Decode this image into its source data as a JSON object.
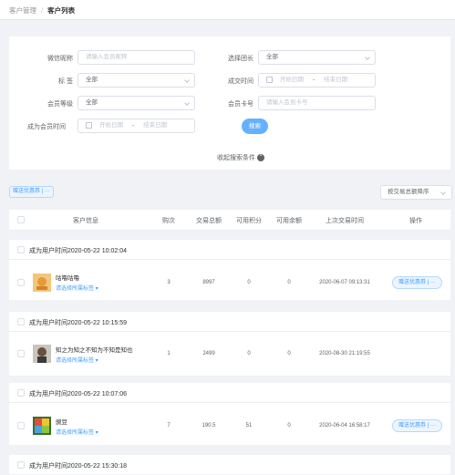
{
  "breadcrumb": {
    "parent": "客户管理",
    "current": "客户列表"
  },
  "filters": {
    "nickname": {
      "label": "微信昵称",
      "placeholder": "请输入会员昵称"
    },
    "leader": {
      "label": "选择团长",
      "value": "全部"
    },
    "tag": {
      "label": "标 签",
      "value": "全部"
    },
    "deal_time": {
      "label": "成交时间",
      "start_placeholder": "开始日期",
      "end_placeholder": "结束日期",
      "separator": "-"
    },
    "level": {
      "label": "会员等级",
      "value": "全部"
    },
    "card": {
      "label": "会员卡号",
      "placeholder": "请输入会员卡号"
    },
    "member_time": {
      "label": "成为会员时间",
      "start_placeholder": "开始日期",
      "end_placeholder": "结束日期",
      "separator": "-"
    },
    "search_label": "搜索",
    "collapse_label": "收起搜索条件"
  },
  "toolbar": {
    "bulk_label": "赠送优惠券 | ···",
    "sort_value": "按交易总额降序"
  },
  "table": {
    "headers": [
      "客户信息",
      "购次",
      "交易总额",
      "可用积分",
      "可用余额",
      "上次交易时间",
      "操作"
    ],
    "rows": [
      {
        "group": "成为用户时间2020-05-22 10:02:04",
        "name": "咕噜咕噜",
        "tag": "请选择所属标签 ▾",
        "count": "3",
        "total": "8997",
        "points": "0",
        "balance": "0",
        "last": "2020-06-07 09:13:31",
        "action": "赠送优惠券 | ···"
      },
      {
        "group": "成为用户时间2020-05-22 10:15:59",
        "name": "知之为知之不知为不知是知也",
        "tag": "请选择所属标签 ▾",
        "count": "1",
        "total": "2499",
        "points": "0",
        "balance": "0",
        "last": "2020-08-30 21:19:55",
        "action": "赠送优惠券 | ···"
      },
      {
        "group": "成为用户时间2020-05-22 10:07:06",
        "name": "豌豆",
        "tag": "请选择所属标签 ▾",
        "count": "7",
        "total": "190.5",
        "points": "51",
        "balance": "0",
        "last": "2020-06-04 16:58:17",
        "action": "赠送优惠券 | ···"
      },
      {
        "group": "成为用户时间2020-05-22 15:30:18"
      }
    ]
  }
}
